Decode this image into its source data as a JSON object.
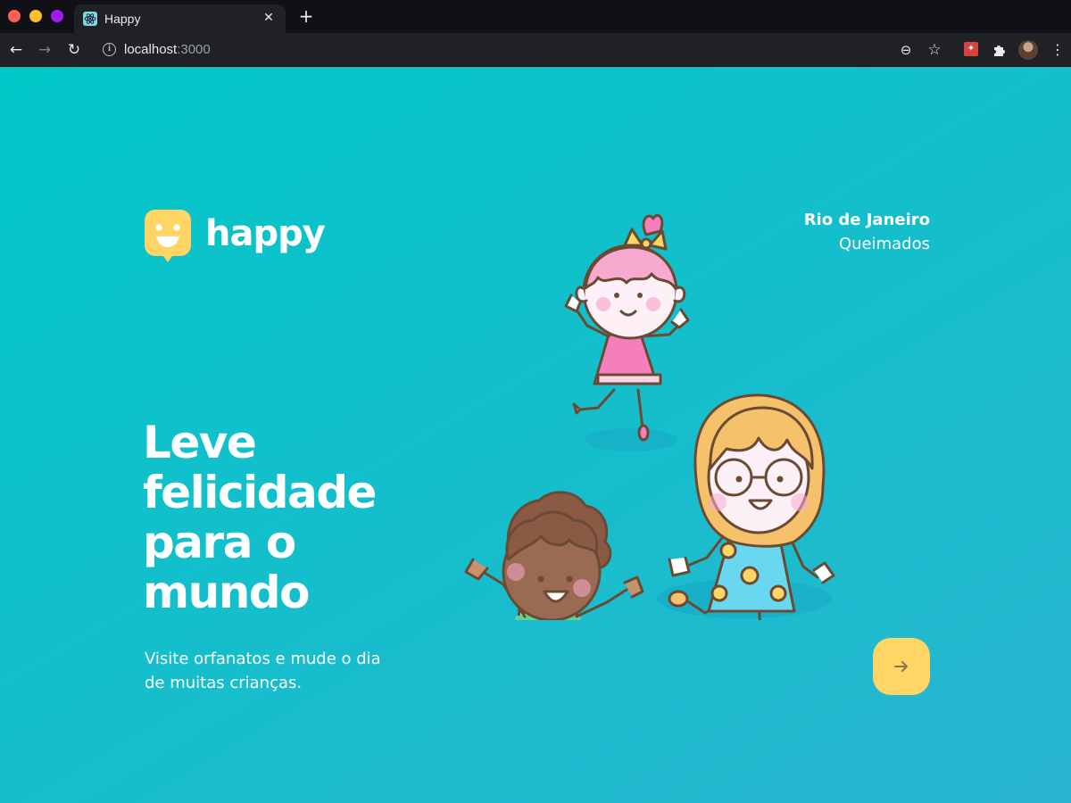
{
  "browser": {
    "tab": {
      "title": "Happy",
      "favicon": "react-icon"
    },
    "address_bar": {
      "host": "localhost",
      "port": ":3000"
    },
    "icons": [
      "back-icon",
      "forward-icon",
      "reload-icon",
      "info-icon",
      "zoom-icon",
      "star-icon",
      "extension-icon",
      "puzzle-icon",
      "profile-avatar",
      "menu-icon"
    ]
  },
  "page": {
    "logo": {
      "text": "happy",
      "icon": "smiley-chat-icon"
    },
    "location": {
      "city": "Rio de Janeiro",
      "state": "Queimados"
    },
    "headline": "Leve felicidade para o mundo",
    "subtitle": "Visite orfanatos e mude o dia de muitas crianças.",
    "enter_button": {
      "icon": "arrow-right-icon"
    }
  },
  "colors": {
    "gradient_start": "#00C7C7",
    "gradient_end": "#29B6D1",
    "button": "#FFD666",
    "logo_yellow": "#FFD666",
    "text": "#FFFFFF"
  }
}
